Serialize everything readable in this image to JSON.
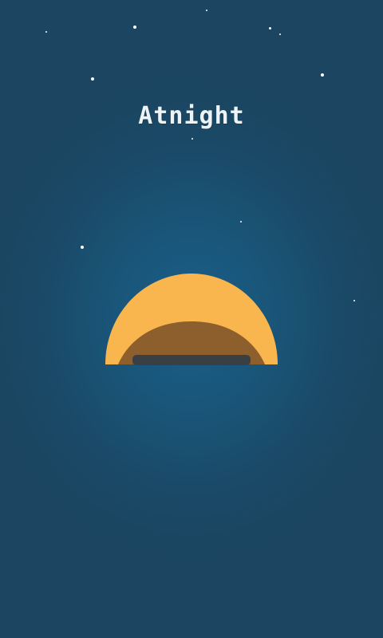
{
  "app": {
    "title": "Atnight"
  },
  "colors": {
    "background": "#1b4a6a",
    "dome_outer": "#f9b64f",
    "dome_inner": "#8d5f2c",
    "base_bar": "#3a3f44",
    "title_text": "#eef3f6"
  },
  "icons": {
    "logo": "sunrise-dome-icon",
    "stars": "star-icon"
  }
}
